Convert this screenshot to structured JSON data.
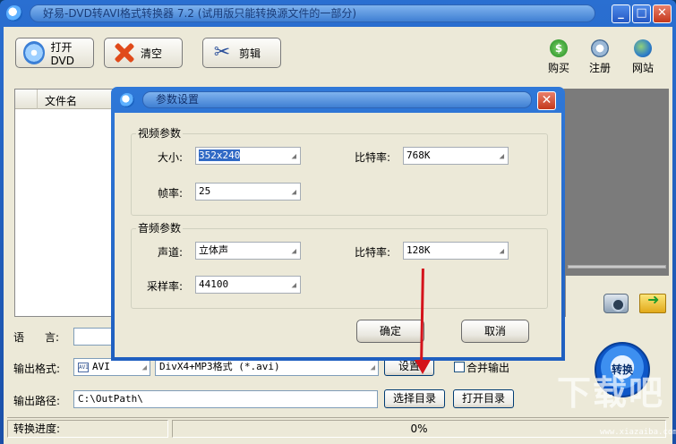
{
  "window": {
    "title": "好易-DVD转AVI格式转换器 7.2 (试用版只能转换源文件的一部分)",
    "minimize": "_",
    "maximize": "□",
    "close": "✕"
  },
  "toolbar": {
    "open_dvd": "打开DVD",
    "clear": "清空",
    "edit": "剪辑",
    "buy": "购买",
    "register": "注册",
    "website": "网站"
  },
  "file_list": {
    "col_name": "文件名"
  },
  "bottom": {
    "language_label": "语",
    "language_label2": "言:",
    "format_label": "输出格式:",
    "format_value": "AVI",
    "format_icon_text": "AVI",
    "codec_value": "DivX4+MP3格式 (*.avi)",
    "settings_button": "设置",
    "merge_label": "合并输出",
    "path_label": "输出路径:",
    "path_value": "C:\\OutPath\\",
    "choose_dir_button": "选择目录",
    "open_dir_button": "打开目录",
    "convert_button": "转换"
  },
  "status": {
    "progress_label": "转换进度:",
    "progress_value": "0%",
    "progress": 0
  },
  "dialog": {
    "title": "参数设置",
    "close": "✕",
    "video_group": "视频参数",
    "size_label": "大小:",
    "size_value": "352x240",
    "video_bitrate_label": "比特率:",
    "video_bitrate_value": "768K",
    "fps_label": "帧率:",
    "fps_value": "25",
    "audio_group": "音频参数",
    "channel_label": "声道:",
    "channel_value": "立体声",
    "audio_bitrate_label": "比特率:",
    "audio_bitrate_value": "128K",
    "samplerate_label": "采样率:",
    "samplerate_value": "44100",
    "ok_button": "确定",
    "cancel_button": "取消"
  },
  "watermark": {
    "text": "下载吧",
    "url": "www.xiazaiba.com"
  },
  "colors": {
    "titlebar": "#2a6fd1",
    "client": "#ece9d8",
    "arrow": "#d4131b"
  }
}
